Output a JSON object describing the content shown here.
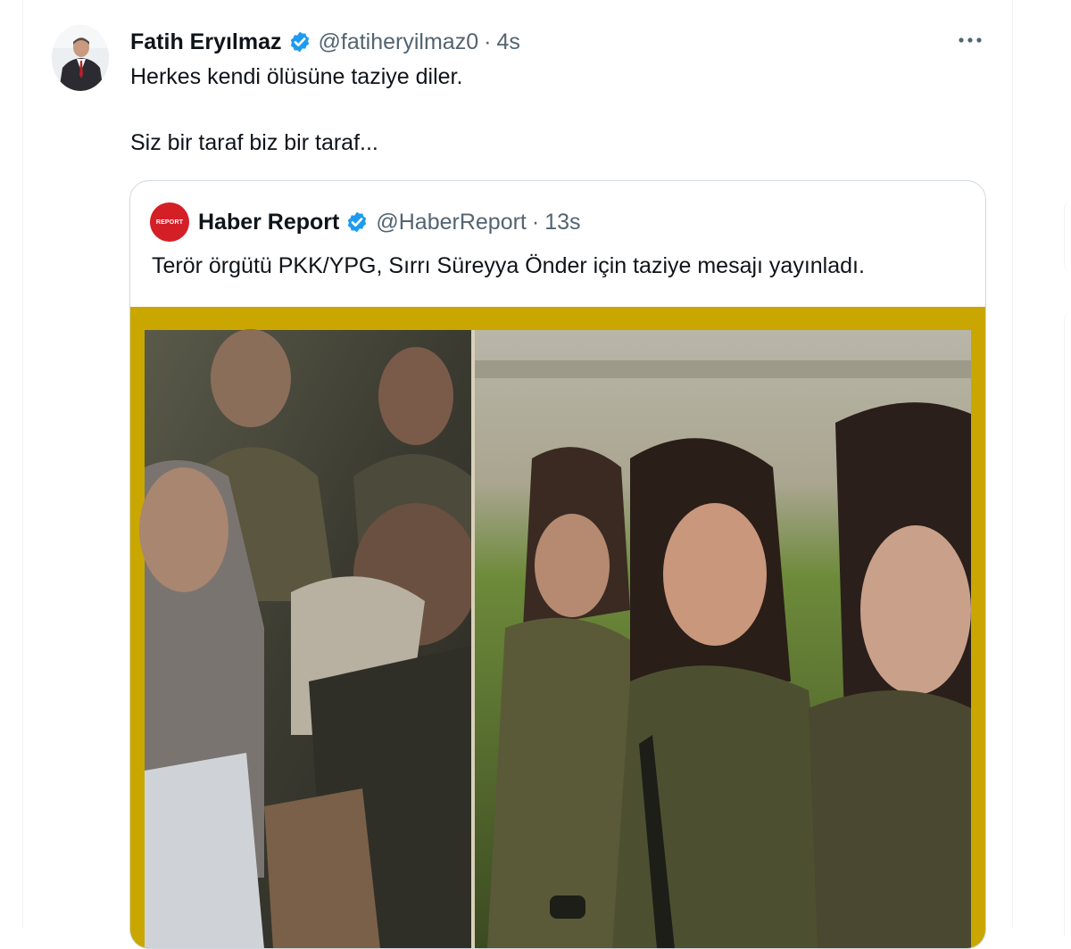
{
  "tweet": {
    "author_name": "Fatih Eryılmaz",
    "handle": "@fatiheryilmaz0",
    "separator": "·",
    "time": "4s",
    "text_line1": "Herkes kendi ölüsüne taziye diler.",
    "text_line2": "Siz bir taraf biz bir taraf...",
    "more_icon": "more-dots-icon",
    "verified_color": "#1d9bf0"
  },
  "quoted": {
    "author_name": "Haber Report",
    "avatar_text": "REPORT",
    "handle": "@HaberReport",
    "separator": "·",
    "time": "13s",
    "text": "Terör örgütü PKK/YPG, Sırrı Süreyya Önder için taziye mesajı yayınladı.",
    "avatar_color": "#d41f26",
    "media_frame_color": "#c9a700"
  }
}
